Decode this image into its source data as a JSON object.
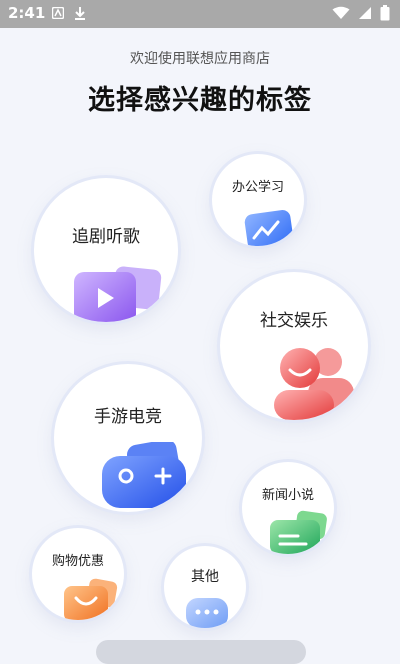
{
  "status": {
    "time": "2:41"
  },
  "header": {
    "subtitle": "欢迎使用联想应用商店",
    "title": "选择感兴趣的标签"
  },
  "tags": {
    "office": "办公学习",
    "drama": "追剧听歌",
    "social": "社交娱乐",
    "games": "手游电竞",
    "news": "新闻小说",
    "shopping": "购物优惠",
    "other": "其他"
  },
  "colors": {
    "drama": "#9b6cf0",
    "office": "#2f6cf6",
    "social": "#ea4b4b",
    "games": "#2e5ef0",
    "news": "#25b160",
    "shopping": "#f07a2c",
    "other": "#6f9df5"
  }
}
